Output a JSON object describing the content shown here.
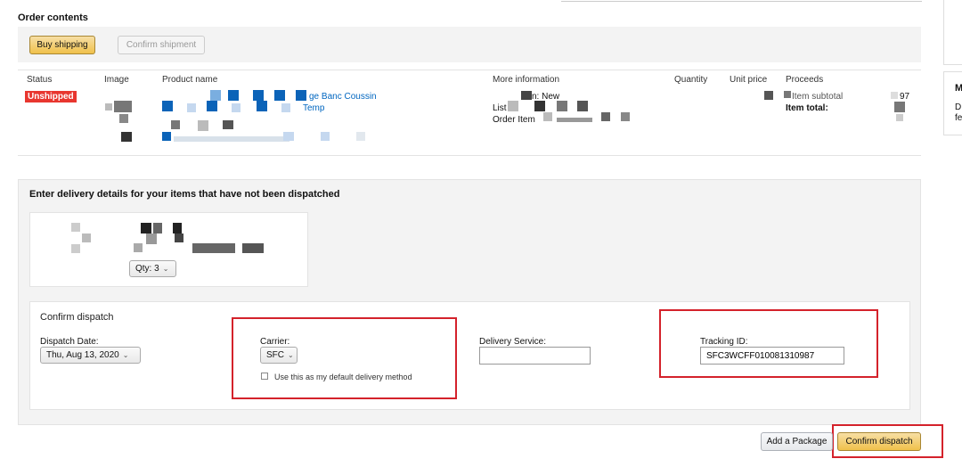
{
  "order": {
    "title": "Order contents",
    "buy_shipping": "Buy shipping",
    "confirm_shipment": "Confirm shipment",
    "columns": [
      "Status",
      "Image",
      "Product name",
      "More information",
      "Quantity",
      "Unit price",
      "Proceeds"
    ],
    "status_badge": "Unshipped",
    "product_name_fragment": "ge Banc Coussin",
    "product_name_fragment2": "Temp",
    "more_info": [
      "n: New",
      "List",
      "Order Item"
    ],
    "proceeds": [
      "Item subtotal",
      "Item total:"
    ],
    "proceeds_value": "97"
  },
  "delivery": {
    "title": "Enter delivery details for your items that have not been dispatched",
    "qty_label": "Qty: 3"
  },
  "confirm": {
    "title": "Confirm dispatch",
    "dispatch_date_label": "Dispatch Date:",
    "dispatch_date_value": "Thu, Aug 13, 2020",
    "carrier_label": "Carrier:",
    "carrier_value": "SFC",
    "default_method_label": "Use this as my default delivery method",
    "delivery_service_label": "Delivery Service:",
    "delivery_service_value": "",
    "tracking_label": "Tracking ID:",
    "tracking_value": "SFC3WCFF010081310987"
  },
  "footer": {
    "add_package": "Add a Package",
    "confirm_dispatch": "Confirm dispatch"
  },
  "right_panel": {
    "letter1": "M",
    "letter2": "D",
    "letter3": "fe"
  },
  "colors": {
    "badge_bg": "#e8362f",
    "link": "#0066c0",
    "highlight": "#d4222b"
  }
}
